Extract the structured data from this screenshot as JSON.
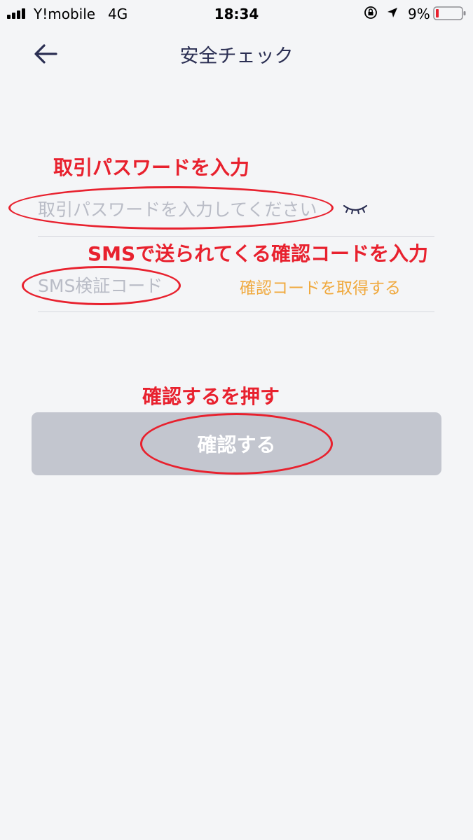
{
  "status_bar": {
    "carrier": "Y!mobile",
    "network": "4G",
    "time": "18:34",
    "battery_percent": "9%",
    "icons": [
      "signal-icon",
      "orientation-lock-icon",
      "location-arrow-icon",
      "battery-low-icon"
    ]
  },
  "nav": {
    "back_icon": "arrow-left-icon",
    "title": "安全チェック"
  },
  "annotations": {
    "password": "取引パスワードを入力",
    "sms": "SMSで送られてくる確認コードを入力",
    "confirm": "確認するを押す"
  },
  "form": {
    "password_placeholder": "取引パスワードを入力してください",
    "password_value": "",
    "password_toggle_icon": "eye-closed-icon",
    "sms_placeholder": "SMS検証コード",
    "sms_value": "",
    "get_code_label": "確認コードを取得する",
    "confirm_label": "確認する"
  },
  "colors": {
    "background": "#f4f5f7",
    "title": "#2b2f53",
    "annotation_red": "#e8212e",
    "link_orange": "#f0a93e",
    "button_disabled": "#c3c6cf",
    "placeholder": "#b9bcc6"
  }
}
